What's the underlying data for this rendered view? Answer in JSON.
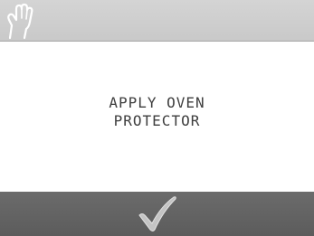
{
  "screen": {
    "top_icon": "oven-glove-icon",
    "message_lines": [
      "APPLY OVEN",
      "PROTECTOR"
    ],
    "confirm_icon": "checkmark-icon"
  },
  "colors": {
    "top_bar": "#cccccc",
    "bottom_bar": "#636363",
    "text": "#3e3e3e",
    "checkmark": "#bdbdbd"
  }
}
